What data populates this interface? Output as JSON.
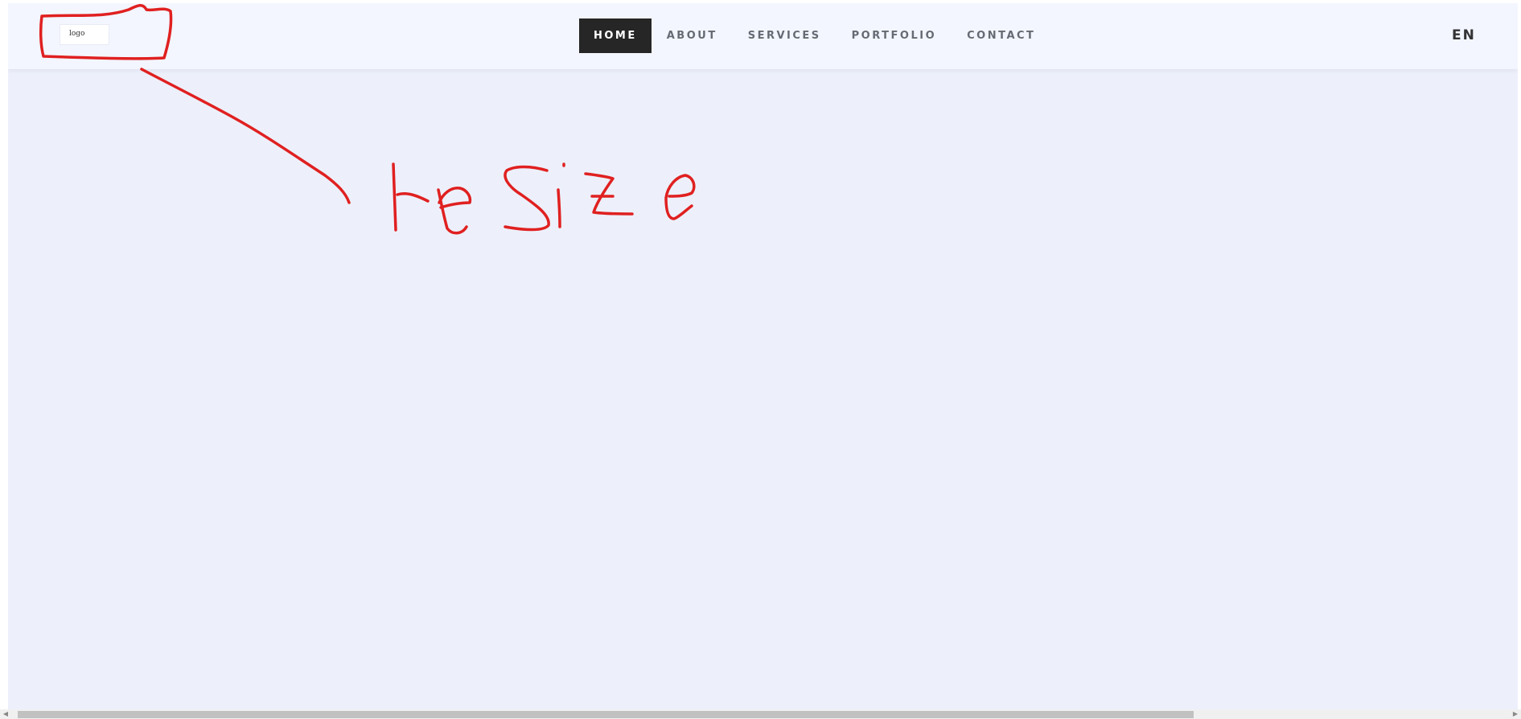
{
  "header": {
    "logo_text": "logo",
    "nav": [
      {
        "label": "HOME",
        "active": true
      },
      {
        "label": "ABOUT",
        "active": false
      },
      {
        "label": "SERVICES",
        "active": false
      },
      {
        "label": "PORTFOLIO",
        "active": false
      },
      {
        "label": "CONTACT",
        "active": false
      }
    ],
    "language": "EN"
  },
  "annotation": {
    "text": "reSize",
    "color": "#e02020"
  },
  "colors": {
    "page_bg": "#edf0fb",
    "navbar_bg": "#f3f6ff",
    "active_nav_bg": "#262626"
  }
}
